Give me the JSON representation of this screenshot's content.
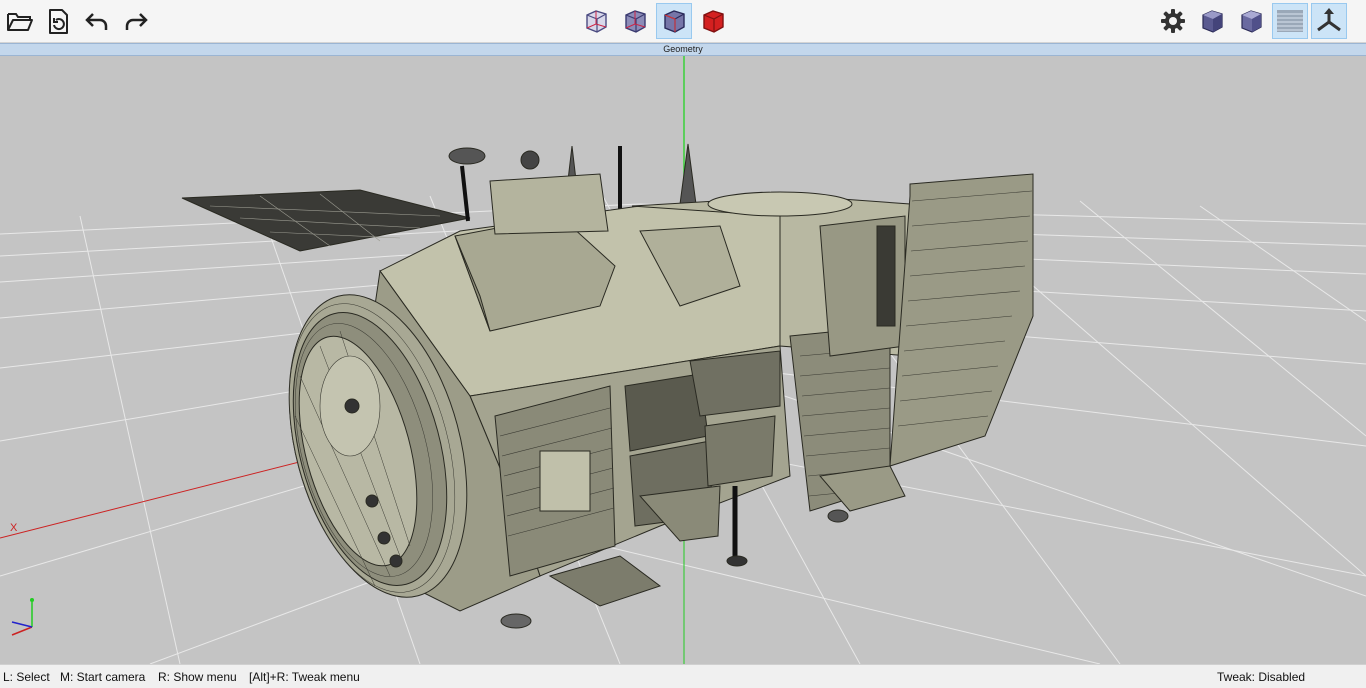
{
  "toolbar": {
    "left_buttons": [
      {
        "name": "open-file",
        "icon": "folder-open-icon"
      },
      {
        "name": "reload-file",
        "icon": "document-refresh-icon"
      },
      {
        "name": "undo",
        "icon": "undo-arrow-icon"
      },
      {
        "name": "redo",
        "icon": "redo-arrow-icon"
      }
    ],
    "render_modes": [
      {
        "name": "wireframe",
        "icon": "cube-wireframe-icon",
        "active": false
      },
      {
        "name": "shaded-wire",
        "icon": "cube-shaded-wire-icon",
        "active": false
      },
      {
        "name": "shaded-with-edges",
        "icon": "cube-shaded-edges-icon",
        "active": true
      },
      {
        "name": "solid",
        "icon": "cube-solid-red-icon",
        "active": false
      }
    ],
    "right_buttons": [
      {
        "name": "settings",
        "icon": "gear-icon",
        "active": false
      },
      {
        "name": "view-cube",
        "icon": "cube-icon",
        "active": false
      },
      {
        "name": "view-cube-alt",
        "icon": "cube-icon",
        "active": false
      },
      {
        "name": "grid-floor",
        "icon": "grid-floor-icon",
        "active": true
      },
      {
        "name": "axes",
        "icon": "axes-icon",
        "active": true
      }
    ]
  },
  "panel": {
    "title": "Geometry"
  },
  "viewport": {
    "background_color": "#c4c4c4",
    "model_color": "#b8b8a2",
    "axis_colors": {
      "x": "#cc2222",
      "y": "#22cc22",
      "z": "#2222cc"
    },
    "labels": {
      "x": "X",
      "y": "Y",
      "z": "Z"
    }
  },
  "status": {
    "left_click": "L: Select",
    "middle_click": "M: Start camera",
    "right_click": "R: Show menu",
    "alt_right_click": "[Alt]+R: Tweak menu",
    "tweak": "Tweak: Disabled"
  }
}
